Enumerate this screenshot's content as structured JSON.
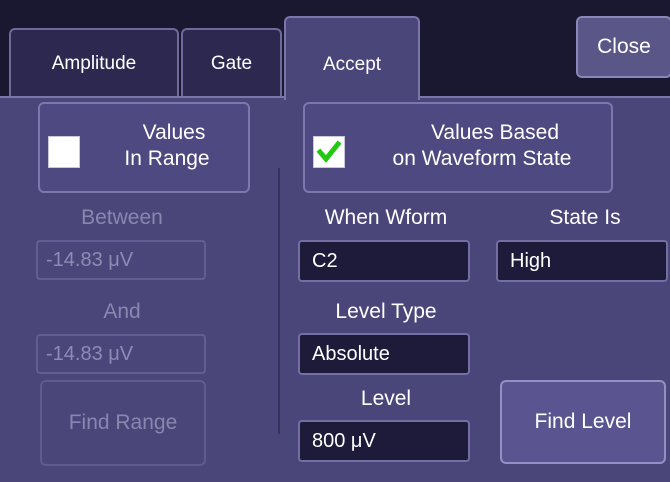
{
  "tabs": [
    {
      "label": "Amplitude"
    },
    {
      "label": "Gate"
    },
    {
      "label": "Accept"
    }
  ],
  "close_label": "Close",
  "values_in_range": {
    "line1": "Values",
    "line2": "In Range",
    "checked": false,
    "between_label": "Between",
    "between_value": "-14.83 μV",
    "and_label": "And",
    "and_value": "-14.83 μV",
    "find_range_label": "Find Range"
  },
  "waveform_state": {
    "line1": "Values Based",
    "line2": "on Waveform State",
    "checked": true,
    "when_wform_label": "When Wform",
    "when_wform_value": "C2",
    "state_is_label": "State Is",
    "state_is_value": "High",
    "level_type_label": "Level Type",
    "level_type_value": "Absolute",
    "level_label": "Level",
    "level_value": "800 μV",
    "find_level_label": "Find Level"
  },
  "colors": {
    "panel": "#4b4679",
    "checkmark": "#22c814",
    "field_bg": "#1d1a3a"
  }
}
